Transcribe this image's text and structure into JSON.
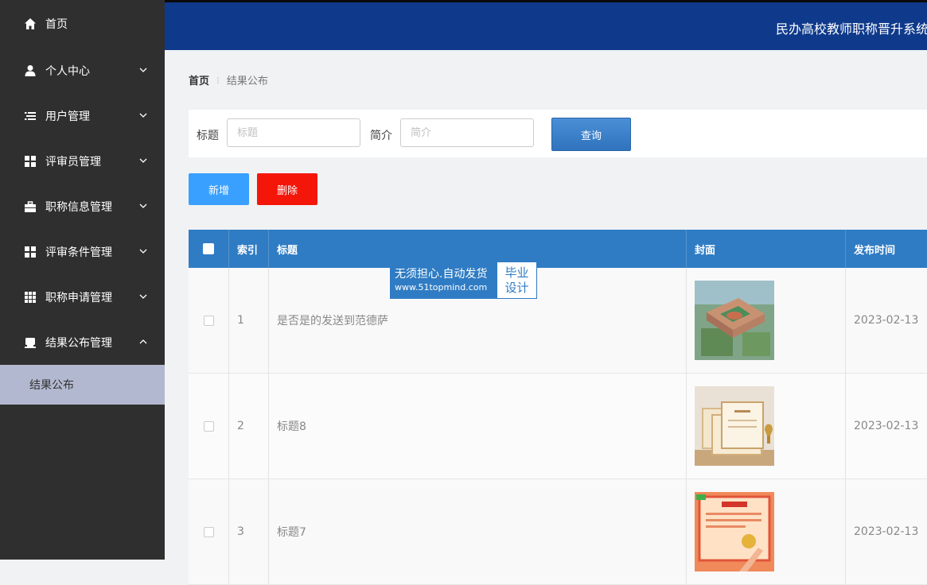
{
  "header": {
    "title": "民办高校教师职称晋升系统"
  },
  "sidebar": {
    "items": [
      {
        "label": "首页",
        "icon": "home-icon",
        "has_children": false
      },
      {
        "label": "个人中心",
        "icon": "user-icon",
        "has_children": true
      },
      {
        "label": "用户管理",
        "icon": "list-icon",
        "has_children": true
      },
      {
        "label": "评审员管理",
        "icon": "grid-icon",
        "has_children": true
      },
      {
        "label": "职称信息管理",
        "icon": "briefcase-icon",
        "has_children": true
      },
      {
        "label": "评审条件管理",
        "icon": "grid-icon",
        "has_children": true
      },
      {
        "label": "职称申请管理",
        "icon": "grid9-icon",
        "has_children": true
      },
      {
        "label": "结果公布管理",
        "icon": "printer-icon",
        "has_children": true,
        "expanded": true
      }
    ],
    "subitem": {
      "label": "结果公布"
    }
  },
  "breadcrumb": {
    "home": "首页",
    "current": "结果公布"
  },
  "search": {
    "title_label": "标题",
    "title_placeholder": "标题",
    "intro_label": "简介",
    "intro_placeholder": "简介",
    "query_button": "查询"
  },
  "actions": {
    "add": "新增",
    "delete": "删除"
  },
  "table": {
    "headers": {
      "index": "索引",
      "title": "标题",
      "cover": "封面",
      "date": "发布时间"
    },
    "rows": [
      {
        "index": "1",
        "title": "是否是的发送到范德萨",
        "cover": "campus-aerial-image",
        "date": "2023-02-13"
      },
      {
        "index": "2",
        "title": "标题8",
        "cover": "certificates-image",
        "date": "2023-02-13"
      },
      {
        "index": "3",
        "title": "标题7",
        "cover": "certificate-signing-image",
        "date": "2023-02-13"
      }
    ]
  },
  "watermark": {
    "line1": "无须担心.自动发货",
    "line2": "www.51topmind.com",
    "right1": "毕业",
    "right2": "设计"
  },
  "colors": {
    "sidebar_bg": "#2f2f2f",
    "header_bg": "#0f3a8c",
    "table_header": "#2f7cc4",
    "add_button": "#3aa0ff",
    "delete_button": "#f5160a",
    "submenu_active": "#b2b8cf"
  }
}
